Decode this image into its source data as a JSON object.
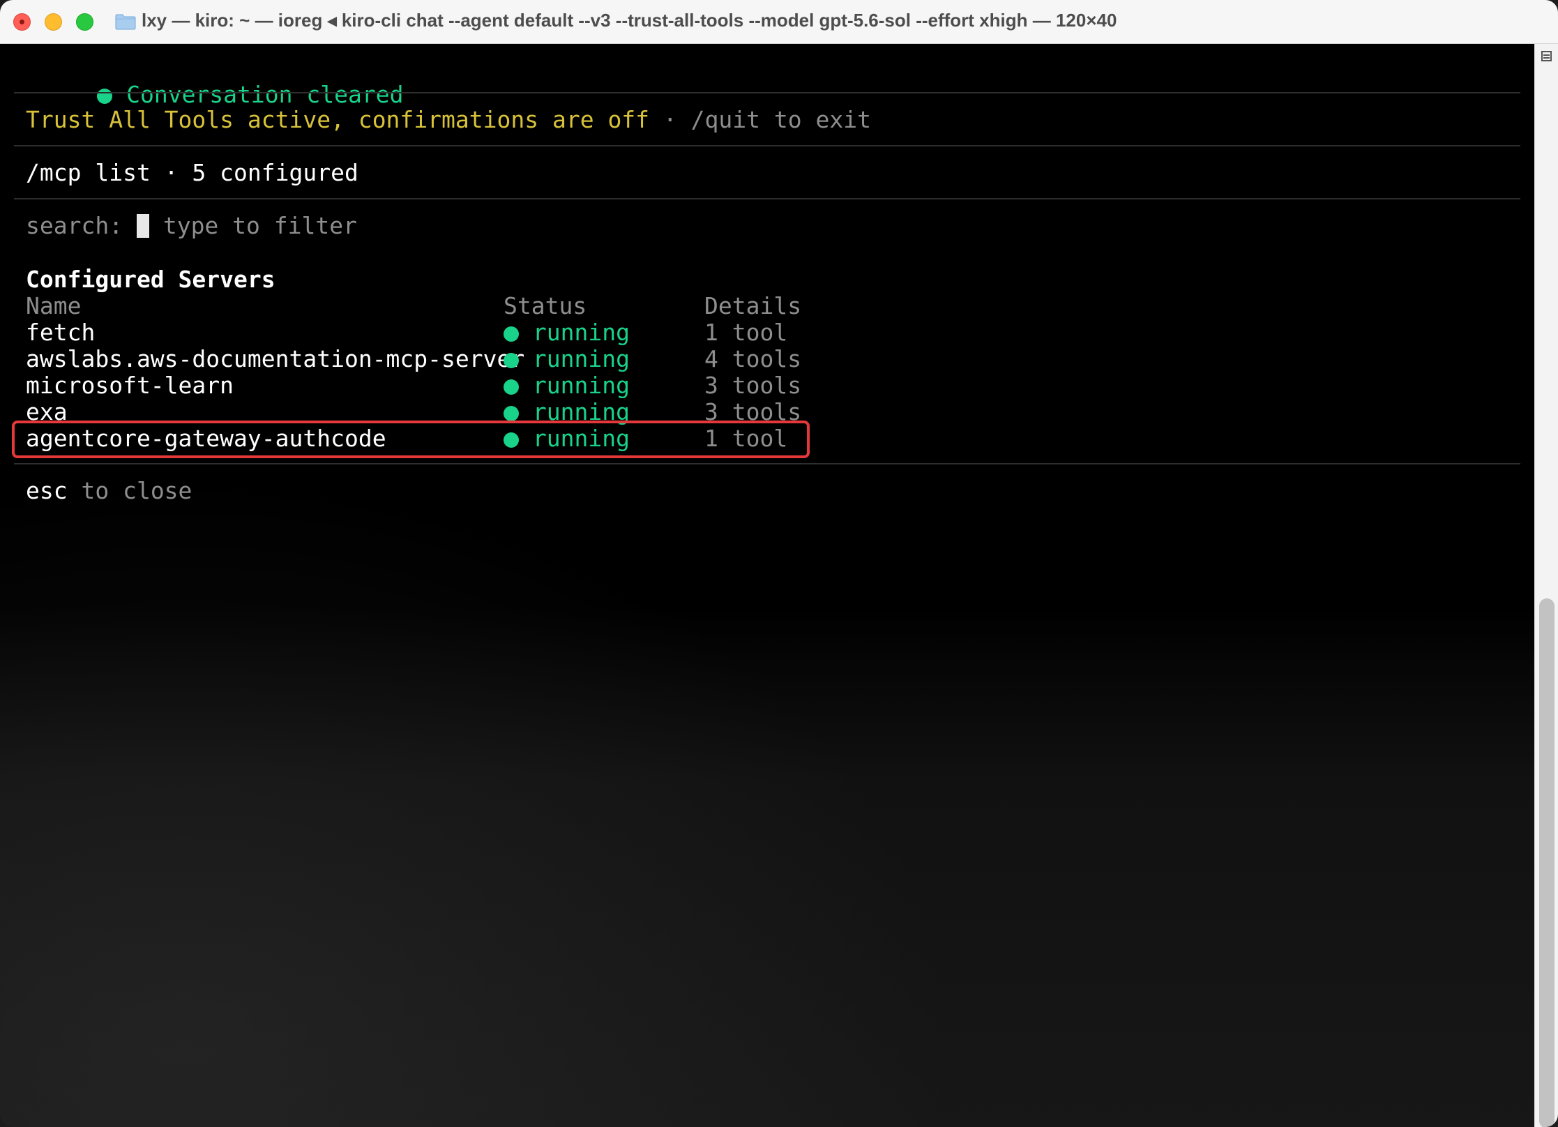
{
  "window": {
    "title": "lxy — kiro: ~ — ioreg ◂ kiro-cli chat --agent default --v3 --trust-all-tools --model gpt-5.6-sol --effort xhigh — 120×40"
  },
  "colors": {
    "accent_green": "#19d38a",
    "warning_yellow": "#d8c23a",
    "highlight_red": "#e5383b",
    "muted_gray": "#8e8e8e"
  },
  "terminal": {
    "status_message": "Conversation cleared",
    "trust_notice": "Trust All Tools active, confirmations are off",
    "trust_separator": " · ",
    "quit_hint": "/quit to exit",
    "command": "/mcp list",
    "command_separator": " · ",
    "configured_count": "5 configured",
    "search_label": "search:",
    "search_placeholder": "type to filter",
    "section_title": "Configured Servers",
    "columns": {
      "name": "Name",
      "status": "Status",
      "details": "Details"
    },
    "servers": [
      {
        "name": "fetch",
        "status": "running",
        "details": "1 tool"
      },
      {
        "name": "awslabs.aws-documentation-mcp-server",
        "status": "running",
        "details": "4 tools"
      },
      {
        "name": "microsoft-learn",
        "status": "running",
        "details": "3 tools"
      },
      {
        "name": "exa",
        "status": "running",
        "details": "3 tools"
      },
      {
        "name": "agentcore-gateway-authcode",
        "status": "running",
        "details": "1 tool",
        "highlighted": true
      }
    ],
    "footer_key": "esc",
    "footer_text": " to close"
  },
  "icons": {
    "close": "close-icon",
    "minimize": "minimize-icon",
    "maximize": "maximize-icon",
    "folder": "folder-icon",
    "scroll_menu": "menu-icon",
    "status_dot": "status-dot-icon"
  }
}
